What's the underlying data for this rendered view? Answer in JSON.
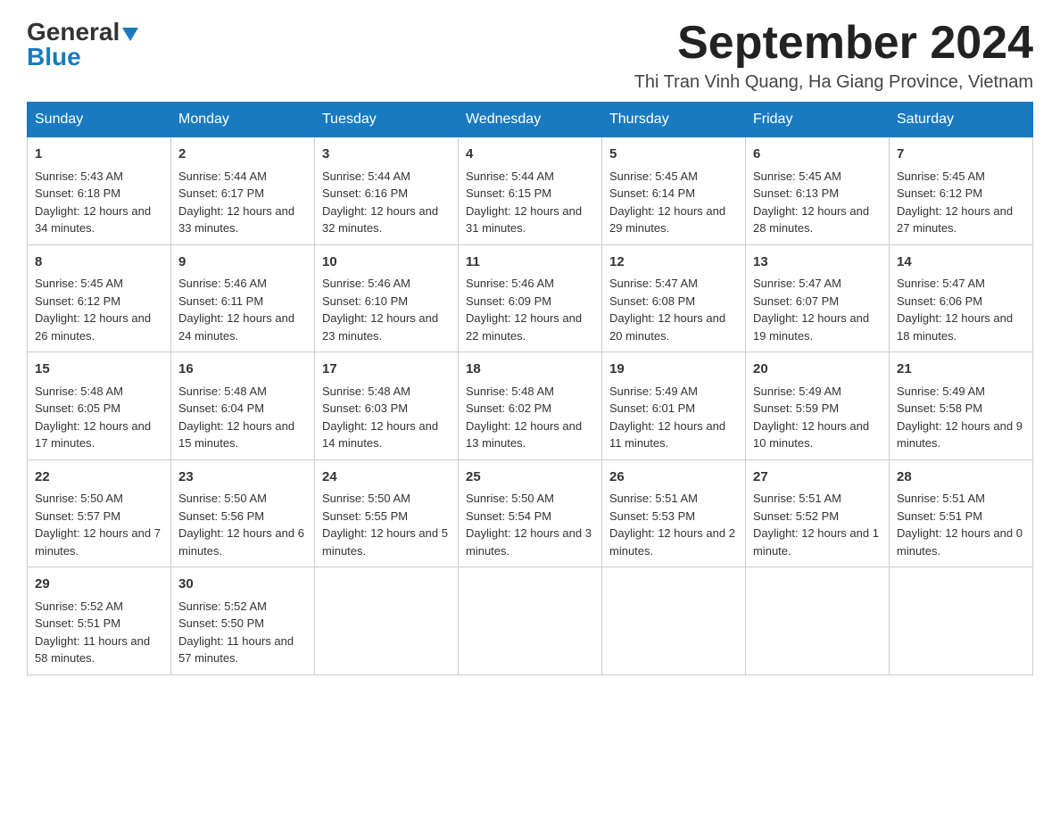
{
  "logo": {
    "general": "General",
    "blue": "Blue"
  },
  "header": {
    "month_title": "September 2024",
    "subtitle": "Thi Tran Vinh Quang, Ha Giang Province, Vietnam"
  },
  "days_of_week": [
    "Sunday",
    "Monday",
    "Tuesday",
    "Wednesday",
    "Thursday",
    "Friday",
    "Saturday"
  ],
  "weeks": [
    [
      {
        "day": "1",
        "sunrise": "Sunrise: 5:43 AM",
        "sunset": "Sunset: 6:18 PM",
        "daylight": "Daylight: 12 hours and 34 minutes."
      },
      {
        "day": "2",
        "sunrise": "Sunrise: 5:44 AM",
        "sunset": "Sunset: 6:17 PM",
        "daylight": "Daylight: 12 hours and 33 minutes."
      },
      {
        "day": "3",
        "sunrise": "Sunrise: 5:44 AM",
        "sunset": "Sunset: 6:16 PM",
        "daylight": "Daylight: 12 hours and 32 minutes."
      },
      {
        "day": "4",
        "sunrise": "Sunrise: 5:44 AM",
        "sunset": "Sunset: 6:15 PM",
        "daylight": "Daylight: 12 hours and 31 minutes."
      },
      {
        "day": "5",
        "sunrise": "Sunrise: 5:45 AM",
        "sunset": "Sunset: 6:14 PM",
        "daylight": "Daylight: 12 hours and 29 minutes."
      },
      {
        "day": "6",
        "sunrise": "Sunrise: 5:45 AM",
        "sunset": "Sunset: 6:13 PM",
        "daylight": "Daylight: 12 hours and 28 minutes."
      },
      {
        "day": "7",
        "sunrise": "Sunrise: 5:45 AM",
        "sunset": "Sunset: 6:12 PM",
        "daylight": "Daylight: 12 hours and 27 minutes."
      }
    ],
    [
      {
        "day": "8",
        "sunrise": "Sunrise: 5:45 AM",
        "sunset": "Sunset: 6:12 PM",
        "daylight": "Daylight: 12 hours and 26 minutes."
      },
      {
        "day": "9",
        "sunrise": "Sunrise: 5:46 AM",
        "sunset": "Sunset: 6:11 PM",
        "daylight": "Daylight: 12 hours and 24 minutes."
      },
      {
        "day": "10",
        "sunrise": "Sunrise: 5:46 AM",
        "sunset": "Sunset: 6:10 PM",
        "daylight": "Daylight: 12 hours and 23 minutes."
      },
      {
        "day": "11",
        "sunrise": "Sunrise: 5:46 AM",
        "sunset": "Sunset: 6:09 PM",
        "daylight": "Daylight: 12 hours and 22 minutes."
      },
      {
        "day": "12",
        "sunrise": "Sunrise: 5:47 AM",
        "sunset": "Sunset: 6:08 PM",
        "daylight": "Daylight: 12 hours and 20 minutes."
      },
      {
        "day": "13",
        "sunrise": "Sunrise: 5:47 AM",
        "sunset": "Sunset: 6:07 PM",
        "daylight": "Daylight: 12 hours and 19 minutes."
      },
      {
        "day": "14",
        "sunrise": "Sunrise: 5:47 AM",
        "sunset": "Sunset: 6:06 PM",
        "daylight": "Daylight: 12 hours and 18 minutes."
      }
    ],
    [
      {
        "day": "15",
        "sunrise": "Sunrise: 5:48 AM",
        "sunset": "Sunset: 6:05 PM",
        "daylight": "Daylight: 12 hours and 17 minutes."
      },
      {
        "day": "16",
        "sunrise": "Sunrise: 5:48 AM",
        "sunset": "Sunset: 6:04 PM",
        "daylight": "Daylight: 12 hours and 15 minutes."
      },
      {
        "day": "17",
        "sunrise": "Sunrise: 5:48 AM",
        "sunset": "Sunset: 6:03 PM",
        "daylight": "Daylight: 12 hours and 14 minutes."
      },
      {
        "day": "18",
        "sunrise": "Sunrise: 5:48 AM",
        "sunset": "Sunset: 6:02 PM",
        "daylight": "Daylight: 12 hours and 13 minutes."
      },
      {
        "day": "19",
        "sunrise": "Sunrise: 5:49 AM",
        "sunset": "Sunset: 6:01 PM",
        "daylight": "Daylight: 12 hours and 11 minutes."
      },
      {
        "day": "20",
        "sunrise": "Sunrise: 5:49 AM",
        "sunset": "Sunset: 5:59 PM",
        "daylight": "Daylight: 12 hours and 10 minutes."
      },
      {
        "day": "21",
        "sunrise": "Sunrise: 5:49 AM",
        "sunset": "Sunset: 5:58 PM",
        "daylight": "Daylight: 12 hours and 9 minutes."
      }
    ],
    [
      {
        "day": "22",
        "sunrise": "Sunrise: 5:50 AM",
        "sunset": "Sunset: 5:57 PM",
        "daylight": "Daylight: 12 hours and 7 minutes."
      },
      {
        "day": "23",
        "sunrise": "Sunrise: 5:50 AM",
        "sunset": "Sunset: 5:56 PM",
        "daylight": "Daylight: 12 hours and 6 minutes."
      },
      {
        "day": "24",
        "sunrise": "Sunrise: 5:50 AM",
        "sunset": "Sunset: 5:55 PM",
        "daylight": "Daylight: 12 hours and 5 minutes."
      },
      {
        "day": "25",
        "sunrise": "Sunrise: 5:50 AM",
        "sunset": "Sunset: 5:54 PM",
        "daylight": "Daylight: 12 hours and 3 minutes."
      },
      {
        "day": "26",
        "sunrise": "Sunrise: 5:51 AM",
        "sunset": "Sunset: 5:53 PM",
        "daylight": "Daylight: 12 hours and 2 minutes."
      },
      {
        "day": "27",
        "sunrise": "Sunrise: 5:51 AM",
        "sunset": "Sunset: 5:52 PM",
        "daylight": "Daylight: 12 hours and 1 minute."
      },
      {
        "day": "28",
        "sunrise": "Sunrise: 5:51 AM",
        "sunset": "Sunset: 5:51 PM",
        "daylight": "Daylight: 12 hours and 0 minutes."
      }
    ],
    [
      {
        "day": "29",
        "sunrise": "Sunrise: 5:52 AM",
        "sunset": "Sunset: 5:51 PM",
        "daylight": "Daylight: 11 hours and 58 minutes."
      },
      {
        "day": "30",
        "sunrise": "Sunrise: 5:52 AM",
        "sunset": "Sunset: 5:50 PM",
        "daylight": "Daylight: 11 hours and 57 minutes."
      },
      null,
      null,
      null,
      null,
      null
    ]
  ]
}
